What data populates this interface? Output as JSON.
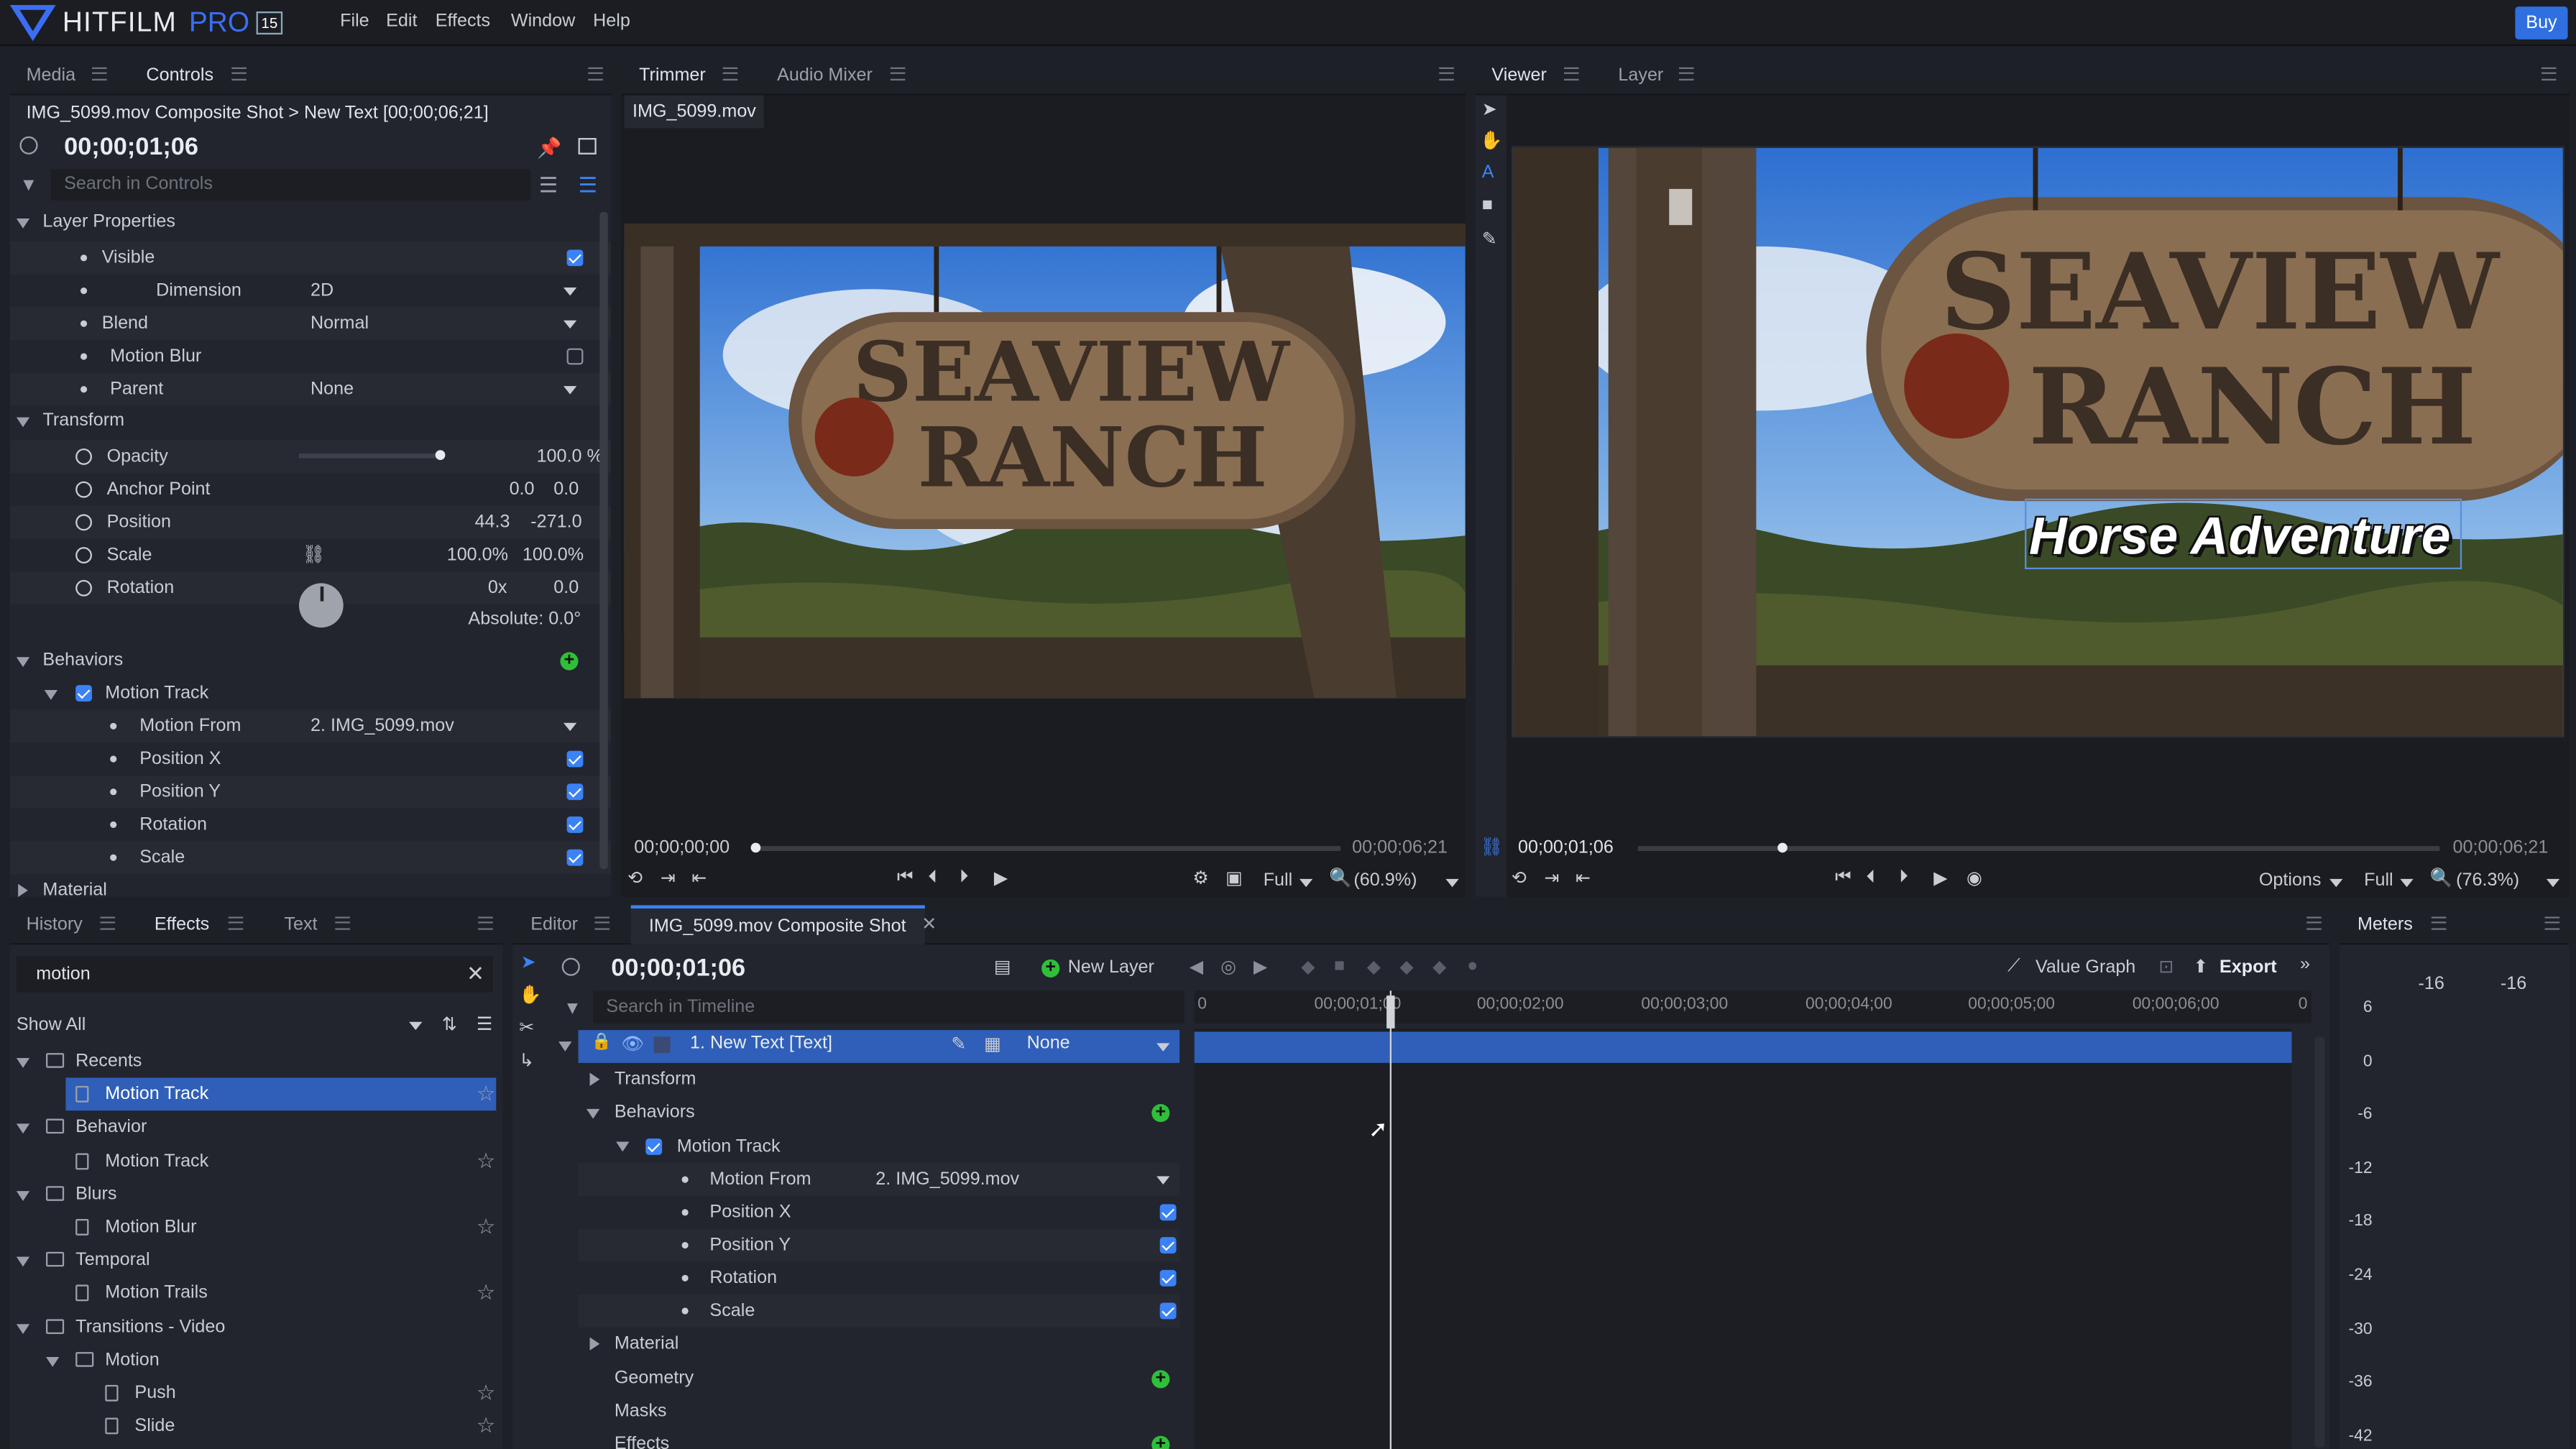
{
  "app": {
    "logo": "HITFILM",
    "logo_pro": "PRO",
    "version": "15",
    "buy": "Buy",
    "menu": [
      "File",
      "Edit",
      "Effects",
      "Window",
      "Help"
    ]
  },
  "controls": {
    "tabs": [
      "Media",
      "Controls"
    ],
    "path": "IMG_5099.mov Composite Shot > New Text [00;00;06;21]",
    "time": "00;00;01;06",
    "search_placeholder": "Search in Controls",
    "layer_properties": "Layer Properties",
    "visible": "Visible",
    "dimension": "Dimension",
    "dimension_val": "2D",
    "blend": "Blend",
    "blend_val": "Normal",
    "motion_blur": "Motion Blur",
    "parent": "Parent",
    "parent_val": "None",
    "transform": "Transform",
    "opacity": "Opacity",
    "opacity_val": "100.0 %",
    "opacity_level": 1.0,
    "anchor": "Anchor Point",
    "anchor_x": "0.0",
    "anchor_y": "0.0",
    "position": "Position",
    "pos_x": "44.3",
    "pos_y": "-271.0",
    "scale": "Scale",
    "scale_x": "100.0%",
    "scale_y": "100.0%",
    "rotation": "Rotation",
    "rot_turns": "0x",
    "rot_deg": "0.0",
    "absolute": "Absolute: 0.0°",
    "behaviors": "Behaviors",
    "motion_track": "Motion Track",
    "motion_from": "Motion From",
    "motion_from_val": "2. IMG_5099.mov",
    "position_x": "Position X",
    "position_y": "Position Y",
    "rotation_b": "Rotation",
    "scale_b": "Scale",
    "material": "Material"
  },
  "trimmer": {
    "tabs": [
      "Trimmer",
      "Audio Mixer"
    ],
    "file": "IMG_5099.mov",
    "start": "00;00;00;00",
    "end": "00;00;06;21",
    "quality": "Full",
    "zoom": "(60.9%)",
    "playhead": 0.0
  },
  "viewer": {
    "tabs": [
      "Viewer",
      "Layer"
    ],
    "time": "00;00;01;06",
    "end": "00;00;06;21",
    "options": "Options",
    "quality": "Full",
    "zoom": "(76.3%)",
    "overlay_text": "Horse Adventure",
    "playhead": 0.18
  },
  "effects": {
    "tabs": [
      "History",
      "Effects",
      "Text"
    ],
    "search": "motion",
    "show": "Show All",
    "tree": [
      {
        "type": "folder",
        "label": "Recents",
        "indent": 0
      },
      {
        "type": "item",
        "label": "Motion Track",
        "indent": 1,
        "selected": true
      },
      {
        "type": "folder",
        "label": "Behavior",
        "indent": 0
      },
      {
        "type": "item",
        "label": "Motion Track",
        "indent": 1
      },
      {
        "type": "folder",
        "label": "Blurs",
        "indent": 0
      },
      {
        "type": "item",
        "label": "Motion Blur",
        "indent": 1
      },
      {
        "type": "folder",
        "label": "Temporal",
        "indent": 0
      },
      {
        "type": "item",
        "label": "Motion Trails",
        "indent": 1
      },
      {
        "type": "folder",
        "label": "Transitions - Video",
        "indent": 0
      },
      {
        "type": "folder",
        "label": "Motion",
        "indent": 1
      },
      {
        "type": "item",
        "label": "Push",
        "indent": 2
      },
      {
        "type": "item",
        "label": "Slide",
        "indent": 2
      }
    ]
  },
  "editor": {
    "tabs": [
      "Editor",
      "IMG_5099.mov Composite Shot"
    ],
    "time": "00;00;01;06",
    "new_layer": "New Layer",
    "value_graph": "Value Graph",
    "export": "Export",
    "search_placeholder": "Search in Timeline",
    "ruler": [
      "0",
      "00;00;01;00",
      "00;00;02;00",
      "00;00;03;00",
      "00;00;04;00",
      "00;00;05;00",
      "00;00;06;00",
      "0"
    ],
    "layer": "1. New Text [Text]",
    "layer_parent": "None",
    "transform": "Transform",
    "behaviors": "Behaviors",
    "motion_track": "Motion Track",
    "motion_from": "Motion From",
    "motion_from_val": "2. IMG_5099.mov",
    "position_x": "Position X",
    "position_y": "Position Y",
    "rotation": "Rotation",
    "scale": "Scale",
    "material": "Material",
    "geometry": "Geometry",
    "masks": "Masks",
    "effects": "Effects"
  },
  "meters": {
    "title": "Meters",
    "left_peak": "-16",
    "right_peak": "-16",
    "scale": [
      "6",
      "0",
      "-6",
      "-12",
      "-18",
      "-24",
      "-30",
      "-36",
      "-42"
    ]
  },
  "colors": {
    "accent": "#3b82f6",
    "selected": "#2f5fb8",
    "add": "#2fbf3a"
  }
}
